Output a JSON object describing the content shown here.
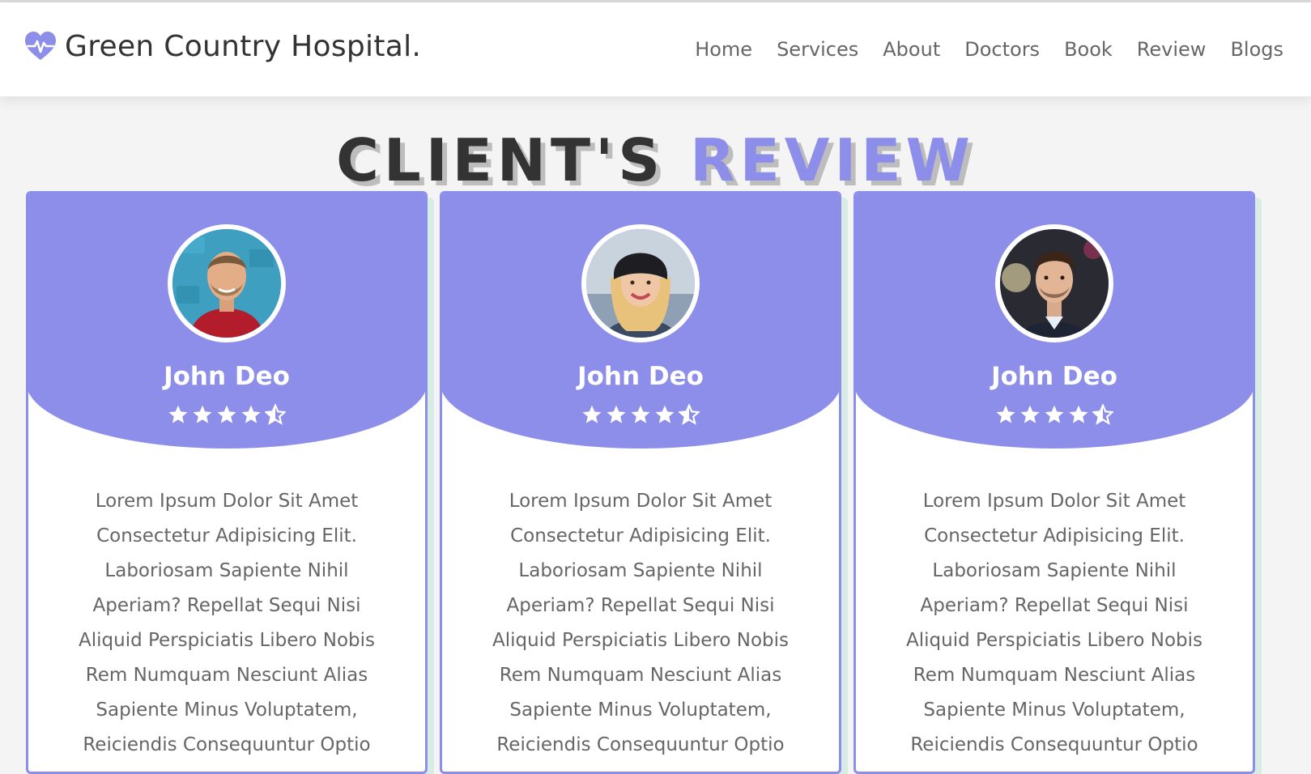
{
  "header": {
    "logo_text": "Green Country Hospital.",
    "logo_icon": "heartbeat-icon",
    "brand_color": "#8c8ee9",
    "nav": [
      {
        "label": "Home"
      },
      {
        "label": "Services"
      },
      {
        "label": "About"
      },
      {
        "label": "Doctors"
      },
      {
        "label": "Book"
      },
      {
        "label": "Review"
      },
      {
        "label": "Blogs"
      }
    ]
  },
  "section": {
    "heading_main": "CLIENT'S",
    "heading_accent": "REVIEW"
  },
  "reviews": [
    {
      "name": "John Deo",
      "rating": 4.5,
      "text": "Lorem Ipsum Dolor Sit Amet Consectetur Adipisicing Elit. Laboriosam Sapiente Nihil Aperiam? Repellat Sequi Nisi Aliquid Perspiciatis Libero Nobis Rem Numquam Nesciunt Alias Sapiente Minus Voluptatem, Reiciendis Consequuntur Optio"
    },
    {
      "name": "John Deo",
      "rating": 4.5,
      "text": "Lorem Ipsum Dolor Sit Amet Consectetur Adipisicing Elit. Laboriosam Sapiente Nihil Aperiam? Repellat Sequi Nisi Aliquid Perspiciatis Libero Nobis Rem Numquam Nesciunt Alias Sapiente Minus Voluptatem, Reiciendis Consequuntur Optio"
    },
    {
      "name": "John Deo",
      "rating": 4.5,
      "text": "Lorem Ipsum Dolor Sit Amet Consectetur Adipisicing Elit. Laboriosam Sapiente Nihil Aperiam? Repellat Sequi Nisi Aliquid Perspiciatis Libero Nobis Rem Numquam Nesciunt Alias Sapiente Minus Voluptatem, Reiciendis Consequuntur Optio"
    }
  ]
}
